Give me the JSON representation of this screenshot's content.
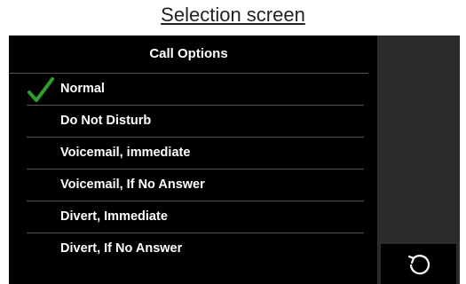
{
  "caption": "Selection screen",
  "panel": {
    "title": "Call Options",
    "options": [
      {
        "label": "Normal",
        "selected": true
      },
      {
        "label": "Do Not Disturb",
        "selected": false
      },
      {
        "label": "Voicemail, immediate",
        "selected": false
      },
      {
        "label": "Voicemail, If No Answer",
        "selected": false
      },
      {
        "label": "Divert, Immediate",
        "selected": false
      },
      {
        "label": "Divert, If No Answer",
        "selected": false
      }
    ]
  },
  "icons": {
    "selected": "checkmark-icon",
    "refresh": "refresh-icon"
  },
  "colors": {
    "checkmark": "#2e9e2e",
    "screen_bg": "#000000",
    "side_strip": "#2b2b2b"
  }
}
